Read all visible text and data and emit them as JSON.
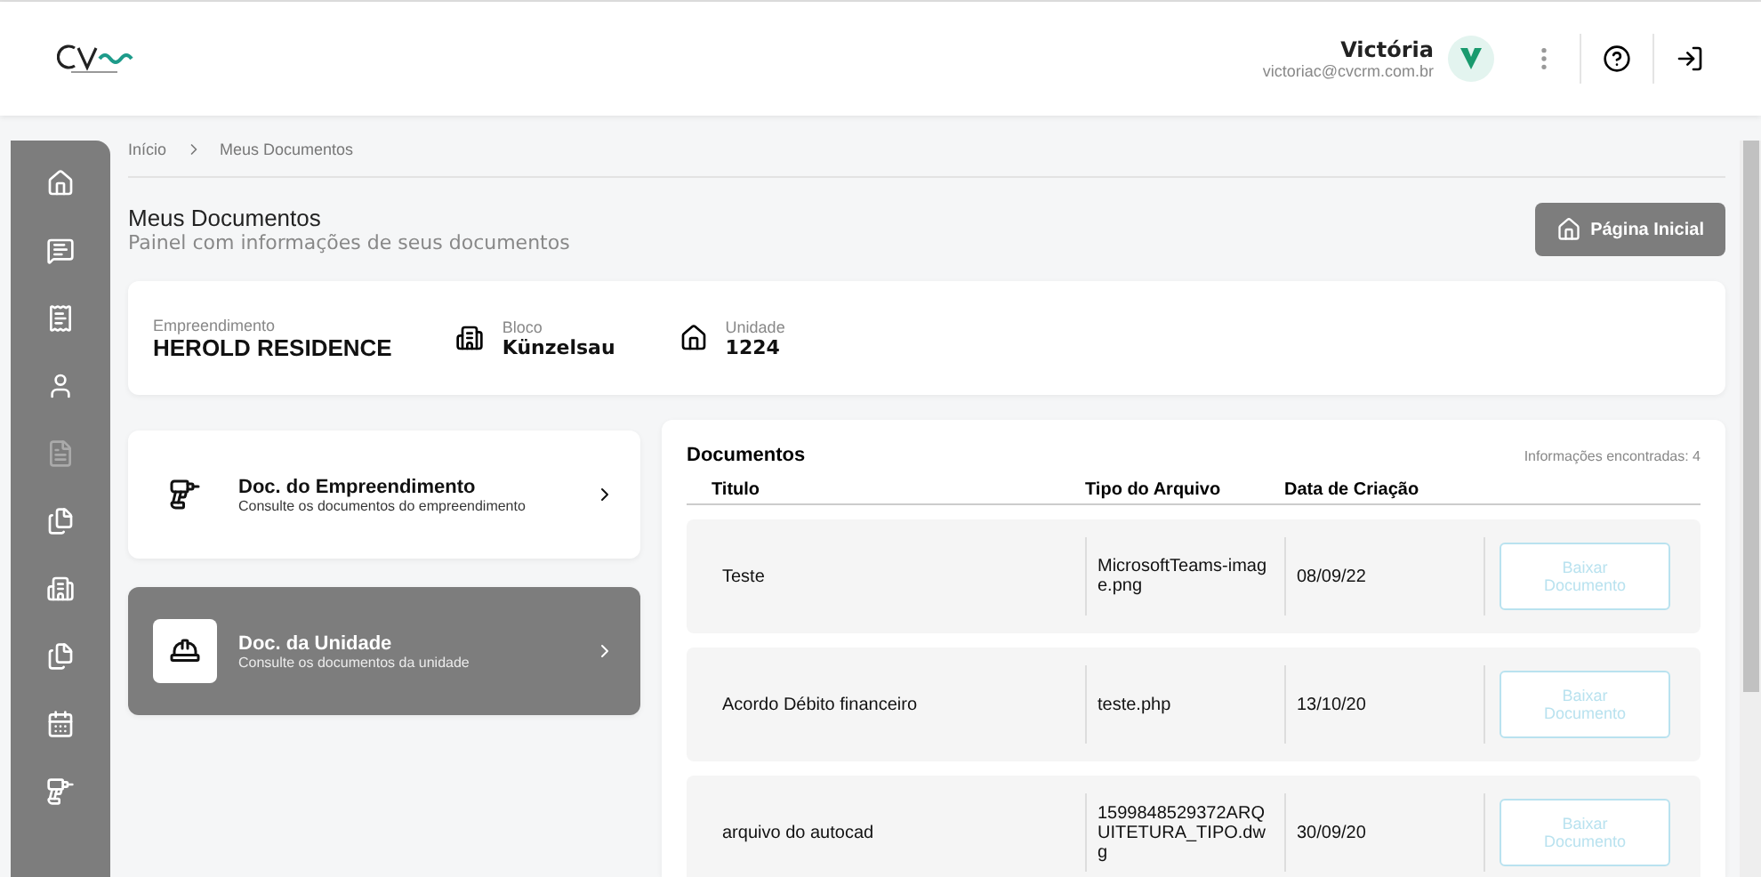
{
  "header": {
    "user_name": "Victória",
    "user_email": "victoriac@cvcrm.com.br"
  },
  "sidebar": {
    "items": [
      {
        "disabled": false
      },
      {
        "disabled": false
      },
      {
        "disabled": false
      },
      {
        "disabled": false
      },
      {
        "disabled": true
      },
      {
        "disabled": false
      },
      {
        "disabled": false
      },
      {
        "disabled": false
      },
      {
        "disabled": false
      },
      {
        "disabled": false
      }
    ]
  },
  "breadcrumb": [
    "Início",
    "Meus Documentos"
  ],
  "page": {
    "title": "Meus Documentos",
    "subtitle": "Painel com informações de seus documentos",
    "home_button": "Página Inicial"
  },
  "property": {
    "fields": [
      {
        "label": "Empreendimento",
        "value": "HEROLD RESIDENCE"
      },
      {
        "label": "Bloco",
        "value": "Künzelsau"
      },
      {
        "label": "Unidade",
        "value": "1224"
      }
    ]
  },
  "categories": [
    {
      "title": "Doc. do Empreendimento",
      "description": "Consulte os documentos do empreendimento",
      "selected": false
    },
    {
      "title": "Doc. da Unidade",
      "description": "Consulte os documentos da unidade",
      "selected": true
    }
  ],
  "documents": {
    "title": "Documentos",
    "count": "Informações encontradas: 4",
    "columns": [
      "Titulo",
      "Tipo do Arquivo",
      "Data de Criação"
    ],
    "rows": [
      {
        "title": "Teste",
        "file": "MicrosoftTeams-image.png",
        "date": "08/09/22",
        "action": "Baixar Documento",
        "disabled": true
      },
      {
        "title": "Acordo Débito financeiro",
        "file": "teste.php",
        "date": "13/10/20",
        "action": "Baixar Documento",
        "disabled": true
      },
      {
        "title": "arquivo do autocad",
        "file": "1599848529372ARQUITETURA_TIPO.dwg",
        "date": "30/09/20",
        "action": "Baixar Documento",
        "disabled": true
      }
    ]
  }
}
